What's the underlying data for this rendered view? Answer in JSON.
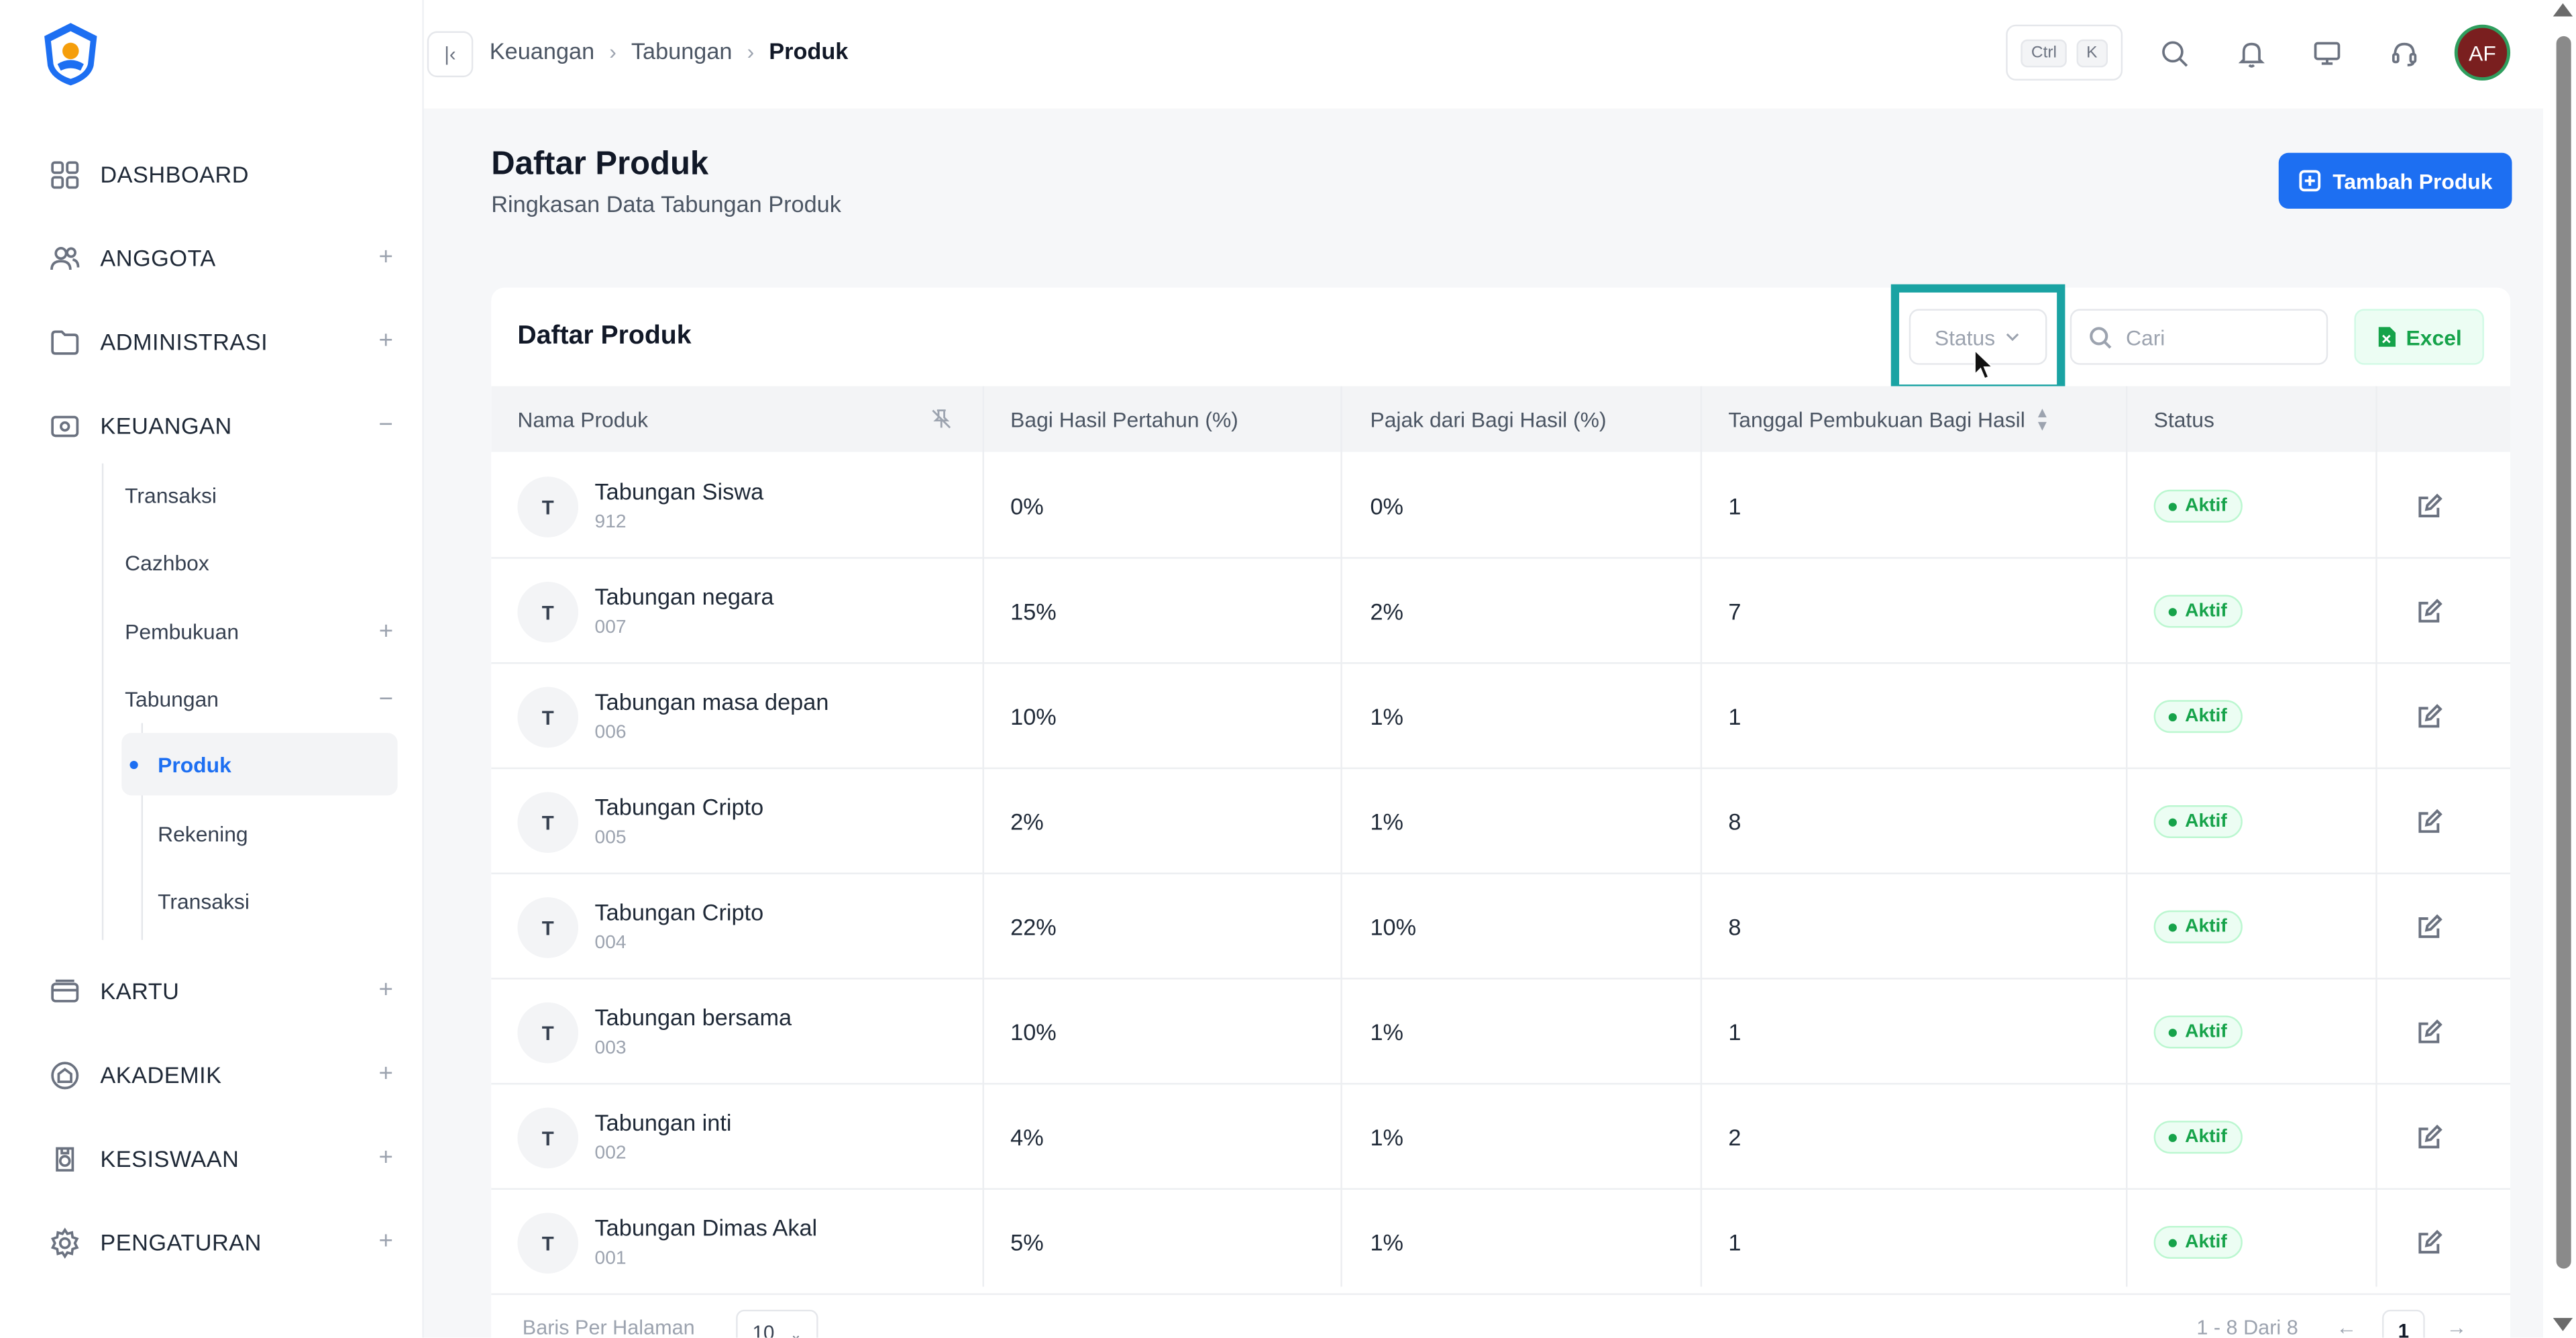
{
  "header": {
    "breadcrumb": [
      "Keuangan",
      "Tabungan",
      "Produk"
    ],
    "shortcut_keys": [
      "Ctrl",
      "K"
    ],
    "avatar_initials": "AF"
  },
  "sidebar": {
    "items": [
      {
        "label": "DASHBOARD",
        "icon": "dashboard-icon",
        "toggle": ""
      },
      {
        "label": "ANGGOTA",
        "icon": "users-icon",
        "toggle": "+"
      },
      {
        "label": "ADMINISTRASI",
        "icon": "folder-icon",
        "toggle": "+"
      },
      {
        "label": "KEUANGAN",
        "icon": "wallet-icon",
        "toggle": "−"
      },
      {
        "label": "KARTU",
        "icon": "card-icon",
        "toggle": "+"
      },
      {
        "label": "AKADEMIK",
        "icon": "academic-icon",
        "toggle": "+"
      },
      {
        "label": "KESISWAAN",
        "icon": "student-icon",
        "toggle": "+"
      },
      {
        "label": "PENGATURAN",
        "icon": "gear-icon",
        "toggle": "+"
      }
    ],
    "keuangan_sub": [
      {
        "label": "Transaksi",
        "toggle": ""
      },
      {
        "label": "Cazhbox",
        "toggle": ""
      },
      {
        "label": "Pembukuan",
        "toggle": "+"
      },
      {
        "label": "Tabungan",
        "toggle": "−"
      }
    ],
    "tabungan_sub": [
      {
        "label": "Produk",
        "active": true
      },
      {
        "label": "Rekening",
        "active": false
      },
      {
        "label": "Transaksi",
        "active": false
      }
    ]
  },
  "page": {
    "title": "Daftar Produk",
    "subtitle": "Ringkasan Data Tabungan Produk",
    "add_button": "Tambah Produk"
  },
  "card": {
    "title": "Daftar Produk",
    "status_filter": "Status",
    "search_placeholder": "Cari",
    "excel_button": "Excel"
  },
  "table": {
    "columns": [
      "Nama Produk",
      "Bagi Hasil Pertahun (%)",
      "Pajak dari Bagi Hasil (%)",
      "Tanggal Pembukuan Bagi Hasil",
      "Status"
    ],
    "rows": [
      {
        "initial": "T",
        "name": "Tabungan Siswa",
        "code": "912",
        "bagi_hasil": "0%",
        "pajak": "0%",
        "tanggal": "1",
        "status": "Aktif"
      },
      {
        "initial": "T",
        "name": "Tabungan negara",
        "code": "007",
        "bagi_hasil": "15%",
        "pajak": "2%",
        "tanggal": "7",
        "status": "Aktif"
      },
      {
        "initial": "T",
        "name": "Tabungan masa depan",
        "code": "006",
        "bagi_hasil": "10%",
        "pajak": "1%",
        "tanggal": "1",
        "status": "Aktif"
      },
      {
        "initial": "T",
        "name": "Tabungan Cripto",
        "code": "005",
        "bagi_hasil": "2%",
        "pajak": "1%",
        "tanggal": "8",
        "status": "Aktif"
      },
      {
        "initial": "T",
        "name": "Tabungan Cripto",
        "code": "004",
        "bagi_hasil": "22%",
        "pajak": "10%",
        "tanggal": "8",
        "status": "Aktif"
      },
      {
        "initial": "T",
        "name": "Tabungan bersama",
        "code": "003",
        "bagi_hasil": "10%",
        "pajak": "1%",
        "tanggal": "1",
        "status": "Aktif"
      },
      {
        "initial": "T",
        "name": "Tabungan inti",
        "code": "002",
        "bagi_hasil": "4%",
        "pajak": "1%",
        "tanggal": "2",
        "status": "Aktif"
      },
      {
        "initial": "T",
        "name": "Tabungan Dimas Akal",
        "code": "001",
        "bagi_hasil": "5%",
        "pajak": "1%",
        "tanggal": "1",
        "status": "Aktif"
      }
    ]
  },
  "footer": {
    "rows_per_page_label": "Baris Per Halaman",
    "rows_per_page_value": "10",
    "range_text": "1 - 8 Dari 8",
    "current_page": "1"
  },
  "colors": {
    "accent": "#1d6ff2",
    "success": "#16a34a",
    "highlight": "#1aa3a3",
    "avatar_bg": "#7a1f1f"
  }
}
